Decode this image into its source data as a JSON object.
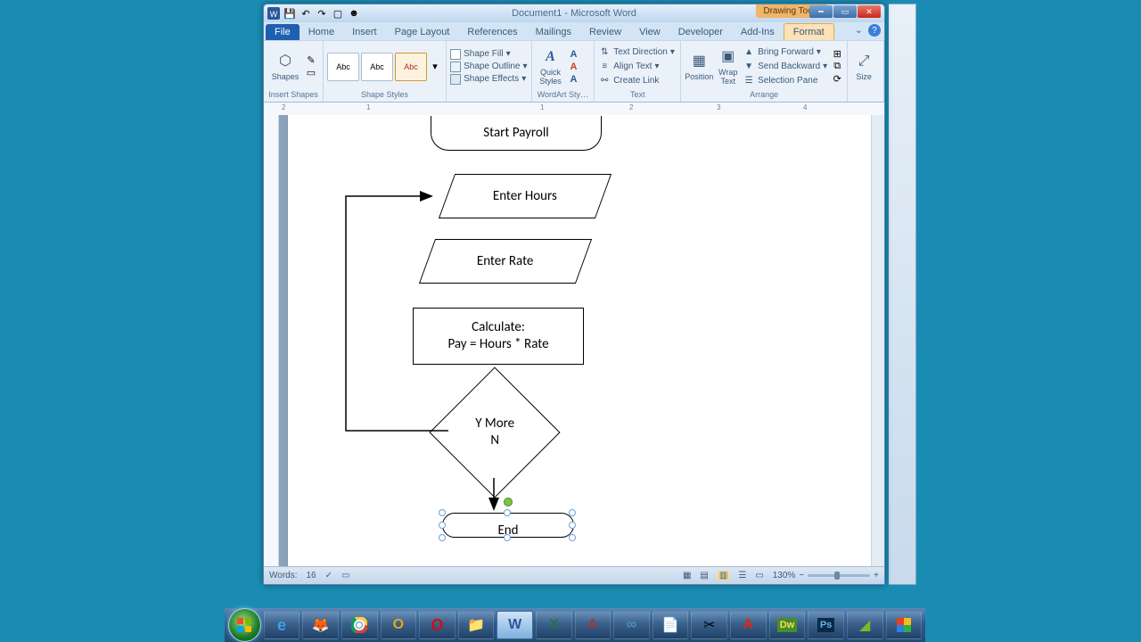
{
  "titlebar": {
    "doc_title": "Document1 - Microsoft Word",
    "context_label": "Drawing Tools"
  },
  "tabs": {
    "file": "File",
    "home": "Home",
    "insert": "Insert",
    "pagelayout": "Page Layout",
    "references": "References",
    "mailings": "Mailings",
    "review": "Review",
    "view": "View",
    "developer": "Developer",
    "addins": "Add-Ins",
    "format": "Format"
  },
  "ribbon": {
    "insert_shapes": {
      "shapes": "Shapes",
      "group": "Insert Shapes"
    },
    "shape_styles": {
      "abc": "Abc",
      "fill": "Shape Fill",
      "outline": "Shape Outline",
      "effects": "Shape Effects",
      "group": "Shape Styles"
    },
    "wordart": {
      "quick": "Quick Styles",
      "group": "WordArt Sty…"
    },
    "text": {
      "direction": "Text Direction",
      "align": "Align Text",
      "link": "Create Link",
      "group": "Text"
    },
    "arrange": {
      "position": "Position",
      "wrap": "Wrap Text",
      "forward": "Bring Forward",
      "backward": "Send Backward",
      "pane": "Selection Pane",
      "group": "Arrange"
    },
    "size": {
      "size": "Size"
    }
  },
  "flowchart": {
    "start": "Start Payroll",
    "hours": "Enter Hours",
    "rate": "Enter Rate",
    "calc1": "Calculate:",
    "calc2": "Pay = Hours * Rate",
    "dec1": "Y   More",
    "dec2": "N",
    "end": "End"
  },
  "statusbar": {
    "words_label": "Words:",
    "words": "16",
    "zoom": "130%"
  },
  "ruler_numbers": [
    "2",
    "1",
    "1",
    "2",
    "3",
    "4"
  ]
}
